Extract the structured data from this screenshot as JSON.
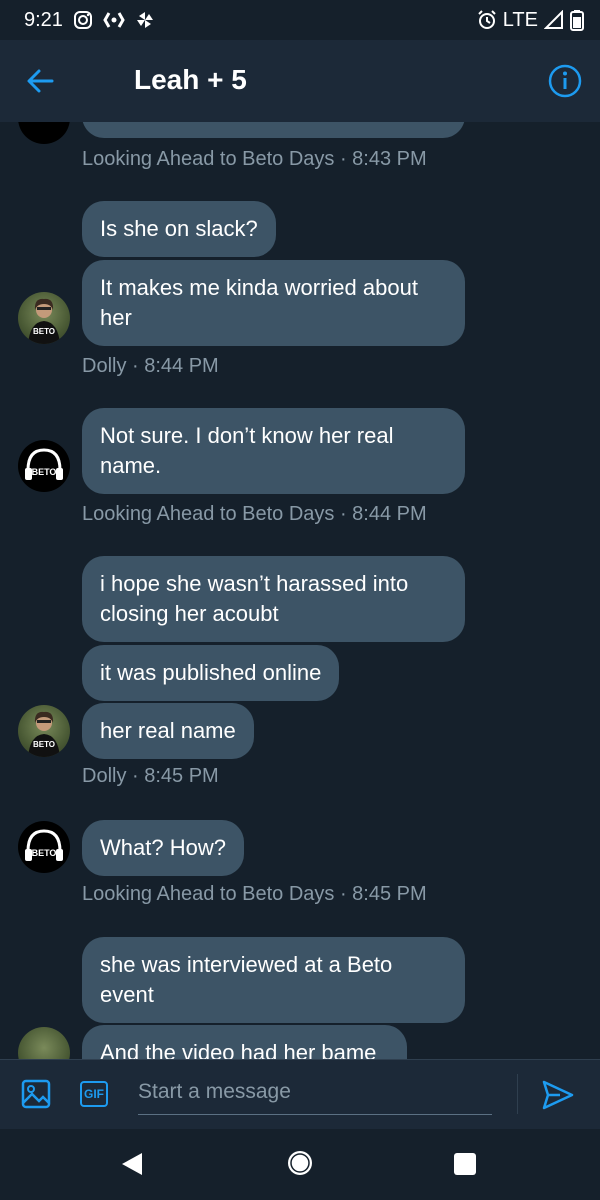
{
  "status_bar": {
    "time": "9:21",
    "network": "LTE",
    "icons_left": [
      "instagram-icon",
      "app-icon",
      "pinwheel-icon"
    ],
    "icons_right": [
      "alarm-icon",
      "signal-icon",
      "battery-icon"
    ]
  },
  "header": {
    "title": "Leah + 5",
    "back_icon": "arrow-left-icon",
    "info_icon": "info-icon"
  },
  "messages": [
    {
      "text": "",
      "sender": "Looking Ahead to Beto Days",
      "time": "8:43 PM",
      "partial": true
    },
    {
      "text": "Is she on slack?",
      "sender": "Dolly"
    },
    {
      "text": "It makes me kinda worried about her",
      "sender": "Dolly",
      "meta": "Dolly · 8:44 PM"
    },
    {
      "text": "Not sure. I don’t know her real name.",
      "sender": "Looking Ahead to Beto Days",
      "meta": "Looking Ahead to Beto Days · 8:44 PM"
    },
    {
      "text": "i hope she wasn’t harassed into closing her acoubt",
      "sender": "Dolly"
    },
    {
      "text": "it was published online",
      "sender": "Dolly"
    },
    {
      "text": "her real name",
      "sender": "Dolly",
      "meta": "Dolly · 8:45 PM"
    },
    {
      "text": "What? How?",
      "sender": "Looking Ahead to Beto Days",
      "meta": "Looking Ahead to Beto Days · 8:45 PM"
    },
    {
      "text": "she was interviewed at a Beto event",
      "sender": "Dolly"
    },
    {
      "text": "And the video had her bame",
      "sender": "Dolly",
      "partial": true
    }
  ],
  "meta_first": "Looking Ahead to Beto Days · 8:43 PM",
  "avatars": {
    "dolly_label": "BETO",
    "lab_label": "BETO"
  },
  "composer": {
    "placeholder": "Start a message",
    "gif_label": "GIF"
  },
  "colors": {
    "background": "#15202b",
    "header": "#1c2938",
    "bubble": "#3d5466",
    "accent": "#1d9bf0",
    "meta_text": "#8899a6"
  }
}
